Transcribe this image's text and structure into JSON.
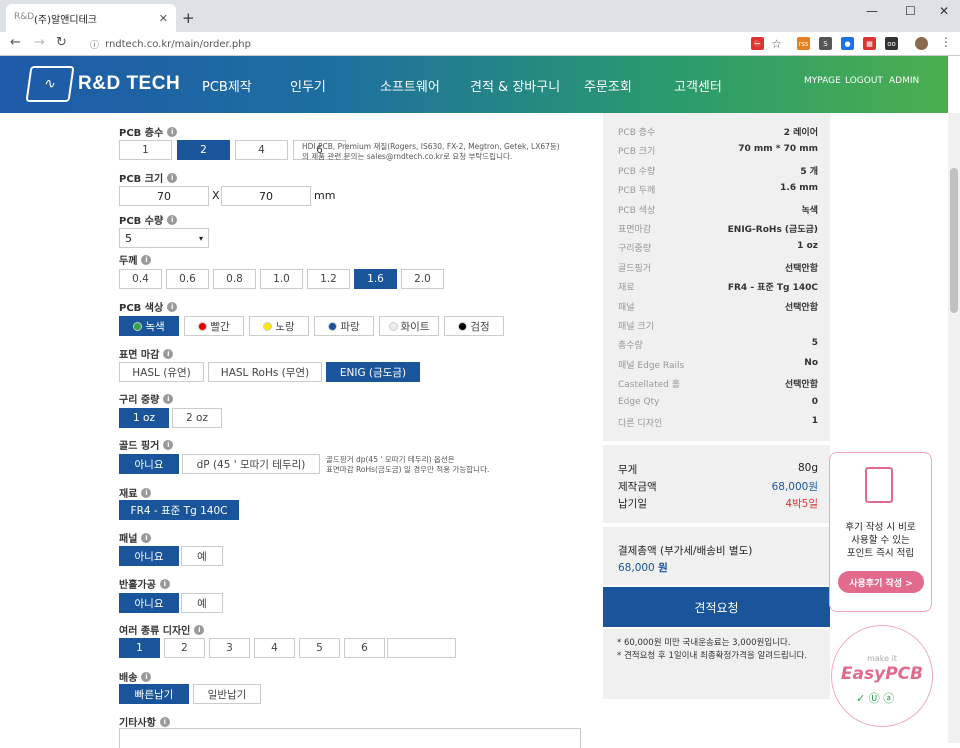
{
  "browser": {
    "tab_title": "(주)알앤디테크",
    "tab_close": "✕",
    "new_tab": "+",
    "win_min": "—",
    "win_max": "☐",
    "win_close": "✕",
    "url": "rndtech.co.kr/main/order.php"
  },
  "header": {
    "logo_text": "R&D TECH",
    "menu": [
      "PCB제작",
      "인두기",
      "소프트웨어",
      "견적 & 장바구니",
      "주문조회",
      "고객센터"
    ],
    "links": [
      "MYPAGE",
      "LOGOUT",
      "ADMIN"
    ]
  },
  "form": {
    "layers": {
      "label": "PCB 층수",
      "options": [
        "1",
        "2",
        "4",
        "6"
      ],
      "selected": 1,
      "note": "HDI PCB, Premium 재질(Rogers, IS630, FX-2, Megtron, Getek, LX67등)\n의 제품 관련 문의는 sales@rndtech.co.kr로 요청 부탁드립니다."
    },
    "size": {
      "label": "PCB 크기",
      "width": "70",
      "x": "X",
      "height": "70",
      "unit": "mm"
    },
    "qty": {
      "label": "PCB 수량",
      "value": "5",
      "arrow": "▾"
    },
    "thickness": {
      "label": "두께",
      "options": [
        "0.4",
        "0.6",
        "0.8",
        "1.0",
        "1.2",
        "1.6",
        "2.0"
      ],
      "selected": 5
    },
    "color": {
      "label": "PCB 색상",
      "options": [
        {
          "name": "녹색",
          "color": "#2ea44f"
        },
        {
          "name": "빨간",
          "color": "#e00000"
        },
        {
          "name": "노랑",
          "color": "#ffe600"
        },
        {
          "name": "파랑",
          "color": "#1a4ea0"
        },
        {
          "name": "화이트",
          "color": "#eeeeee"
        },
        {
          "name": "검정",
          "color": "#000000"
        }
      ],
      "selected": 0
    },
    "finish": {
      "label": "표면 마감",
      "options": [
        "HASL (유연)",
        "HASL RoHs (무연)",
        "ENIG (금도금)"
      ],
      "selected": 2
    },
    "copper": {
      "label": "구리 중량",
      "options": [
        "1 oz",
        "2 oz"
      ],
      "selected": 0
    },
    "gold": {
      "label": "골드 핑거",
      "options": [
        "아니요",
        "dP (45 ' 모따기 테두리)"
      ],
      "selected": 0,
      "note": "골드핑거 dp(45 ' 모따기 테두리) 옵션은\n표면마감 RoHs(금도금) 일 경우만 적용 가능합니다."
    },
    "material": {
      "label": "재료",
      "options": [
        "FR4 - 표준 Tg 140C"
      ],
      "selected": 0
    },
    "panel": {
      "label": "패널",
      "options": [
        "아니요",
        "예"
      ],
      "selected": 0
    },
    "halfcut": {
      "label": "반홀가공",
      "options": [
        "아니요",
        "예"
      ],
      "selected": 0
    },
    "designs": {
      "label": "여러 종류 디자인",
      "options": [
        "1",
        "2",
        "3",
        "4",
        "5",
        "6",
        ""
      ],
      "selected": 0
    },
    "shipping": {
      "label": "배송",
      "options": [
        "빠른납기",
        "일반납기"
      ],
      "selected": 0
    },
    "etc": {
      "label": "기타사항"
    }
  },
  "summary": {
    "rows": [
      {
        "k": "PCB 층수",
        "v": "2 레이어"
      },
      {
        "k": "PCB 크기",
        "v": "70 mm * 70 mm"
      },
      {
        "k": "PCB 수량",
        "v": "5 개"
      },
      {
        "k": "PCB 두께",
        "v": "1.6 mm"
      },
      {
        "k": "PCB 색상",
        "v": "녹색"
      },
      {
        "k": "표면마감",
        "v": "ENIG-RoHs (금도금)"
      },
      {
        "k": "구리중량",
        "v": "1 oz"
      },
      {
        "k": "골드핑거",
        "v": "선택안함"
      },
      {
        "k": "재료",
        "v": "FR4 - 표준 Tg 140C"
      },
      {
        "k": "패널",
        "v": "선택안함"
      },
      {
        "k": "패널 크기",
        "v": ""
      },
      {
        "k": "총수량",
        "v": "5"
      },
      {
        "k": "패널 Edge Rails",
        "v": "No"
      },
      {
        "k": "Castellated 홀",
        "v": "선택안함"
      },
      {
        "k": "Edge Qty",
        "v": "0"
      },
      {
        "k": "다른 디자인",
        "v": "1"
      }
    ],
    "weight_k": "무게",
    "weight_v": "80g",
    "price_k": "제작금액",
    "price_v": "68,000원",
    "due_k": "납기일",
    "due_v": "4박5일",
    "total_label": "결제총액 (부가세/배송비 별도)",
    "total_value": "68,000",
    "total_unit": "원",
    "quote_button": "견적요청",
    "notes": [
      "* 60,000원 미만 국내운송료는 3,000원입니다.",
      "* 견적요청 후 1일이내 최종확정가격을 알려드립니다."
    ]
  },
  "promo": {
    "review_text": "후기 작성 시 비로\n사용할 수 있는\n포인트 즉시 적립",
    "review_button": "사용후기 작성 >",
    "make_it": "make it",
    "easypcb": "EasyPCB"
  }
}
